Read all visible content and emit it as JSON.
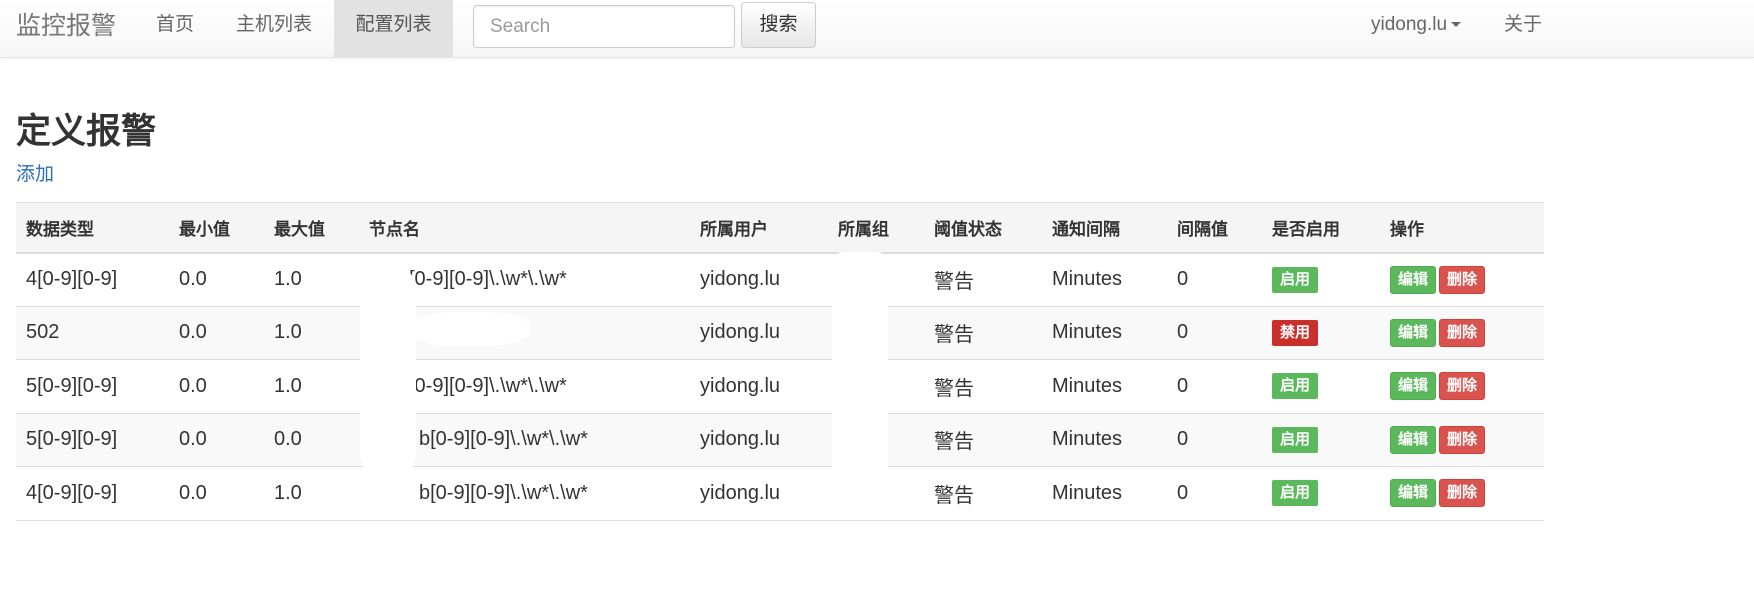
{
  "navbar": {
    "brand": "监控报警",
    "links": [
      "首页",
      "主机列表",
      "配置列表"
    ],
    "search_placeholder": "Search",
    "search_button": "搜索",
    "user": "yidong.lu",
    "about": "关于"
  },
  "page": {
    "title": "定义报警",
    "add_link": "添加"
  },
  "table": {
    "headers": [
      "数据类型",
      "最小值",
      "最大值",
      "节点名",
      "所属用户",
      "所属组",
      "阈值状态",
      "通知间隔",
      "间隔值",
      "是否启用",
      "操作"
    ],
    "rows": [
      {
        "type": "4[0-9][0-9]",
        "min": "0.0",
        "max": "1.0",
        "node": "[0-9][0-9]\\.\\w*\\.\\w*",
        "user": "yidong.lu",
        "group": "",
        "status": "警告",
        "interval": "Minutes",
        "value": "0",
        "enabled": "启用",
        "edit": "编辑",
        "delete": "删除"
      },
      {
        "type": "502",
        "min": "0.0",
        "max": "1.0",
        "node": "",
        "user": "yidong.lu",
        "group": "",
        "status": "警告",
        "interval": "Minutes",
        "value": "0",
        "enabled": "禁用",
        "edit": "编辑",
        "delete": "删除"
      },
      {
        "type": "5[0-9][0-9]",
        "min": "0.0",
        "max": "1.0",
        "node": "y[0-9][0-9]\\.\\w*\\.\\w*",
        "user": "yidong.lu",
        "group": "",
        "status": "警告",
        "interval": "Minutes",
        "value": "0",
        "enabled": "启用",
        "edit": "编辑",
        "delete": "删除"
      },
      {
        "type": "5[0-9][0-9]",
        "min": "0.0",
        "max": "0.0",
        "node": "b[0-9][0-9]\\.\\w*\\.\\w*",
        "user": "yidong.lu",
        "group": "",
        "status": "警告",
        "interval": "Minutes",
        "value": "0",
        "enabled": "启用",
        "edit": "编辑",
        "delete": "删除"
      },
      {
        "type": "4[0-9][0-9]",
        "min": "0.0",
        "max": "1.0",
        "node": "b[0-9][0-9]\\.\\w*\\.\\w*",
        "user": "yidong.lu",
        "group": "",
        "status": "警告",
        "interval": "Minutes",
        "value": "0",
        "enabled": "启用",
        "edit": "编辑",
        "delete": "删除"
      }
    ]
  },
  "colors": {
    "link": "#2a6ebb",
    "enabled": "#5cb85c",
    "disabled": "#c9302c",
    "delete": "#d9534f"
  }
}
